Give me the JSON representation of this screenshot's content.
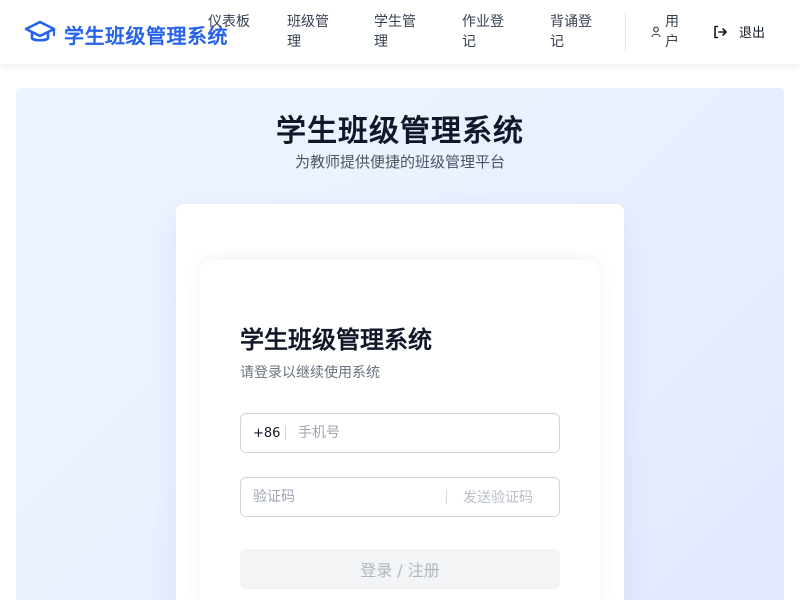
{
  "header": {
    "brand_title": "学生班级管理系统",
    "nav": [
      {
        "label": "仪表板"
      },
      {
        "label": "班级管理"
      },
      {
        "label": "学生管理"
      },
      {
        "label": "作业登记"
      },
      {
        "label": "背诵登记"
      }
    ],
    "user_label": "用户",
    "logout_label": "退出",
    "icons": {
      "brand": "graduation-cap-icon",
      "user": "user-icon",
      "logout": "logout-icon"
    }
  },
  "hero": {
    "title": "学生班级管理系统",
    "subtitle": "为教师提供便捷的班级管理平台"
  },
  "login": {
    "title": "学生班级管理系统",
    "subtitle": "请登录以继续使用系统",
    "country_code": "+86",
    "phone_placeholder": "手机号",
    "phone_value": "",
    "code_placeholder": "验证码",
    "code_value": "",
    "send_code_label": "发送验证码",
    "submit_label": "登录 / 注册"
  },
  "colors": {
    "brand": "#2563eb",
    "hero_bg_start": "#eef4ff",
    "hero_bg_end": "#e3e8fd",
    "button_disabled_bg": "#f3f4f6"
  }
}
